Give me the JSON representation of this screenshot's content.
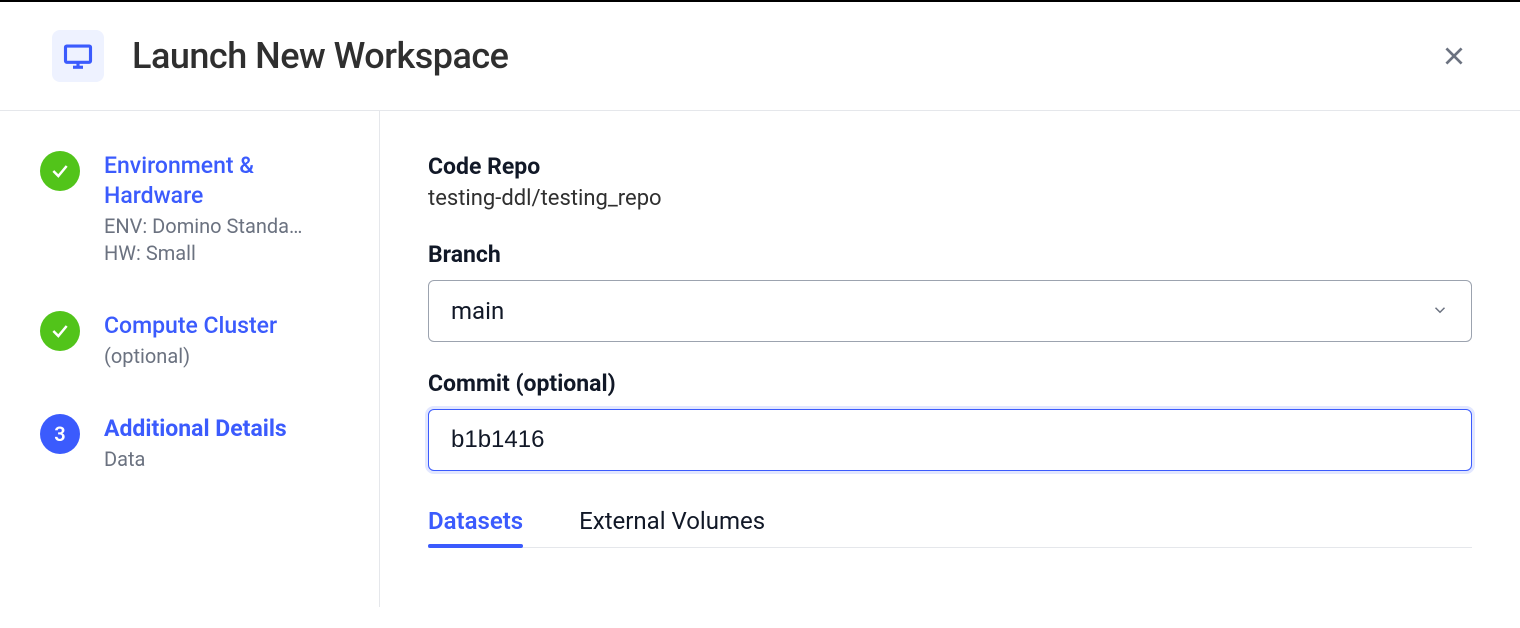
{
  "header": {
    "title": "Launch New Workspace"
  },
  "steps": [
    {
      "title": "Environment & Hardware",
      "sub1": "ENV: Domino Standa…",
      "sub2": "HW: Small"
    },
    {
      "title": "Compute Cluster",
      "sub1": "(optional)"
    },
    {
      "number": "3",
      "title": "Additional Details",
      "sub1": "Data"
    }
  ],
  "main": {
    "codeRepo": {
      "label": "Code Repo",
      "value": "testing-ddl/testing_repo"
    },
    "branch": {
      "label": "Branch",
      "value": "main"
    },
    "commit": {
      "label": "Commit (optional)",
      "value": "b1b1416"
    },
    "tabs": [
      {
        "label": "Datasets"
      },
      {
        "label": "External Volumes"
      }
    ]
  }
}
